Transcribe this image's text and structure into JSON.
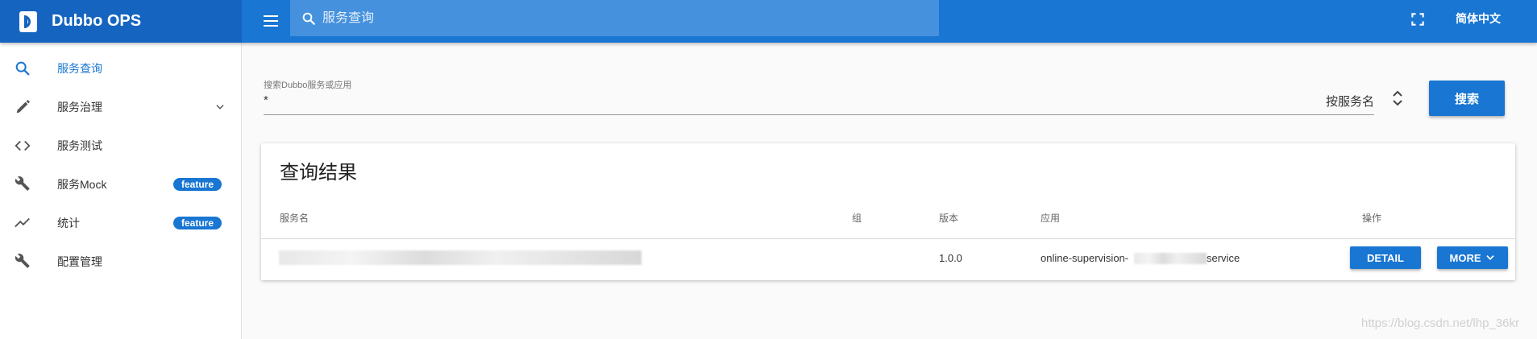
{
  "app": {
    "title": "Dubbo OPS"
  },
  "topbar": {
    "search_placeholder": "服务查询",
    "language": "简体中文"
  },
  "sidebar": {
    "items": [
      {
        "label": "服务查询",
        "icon": "search-icon",
        "active": true
      },
      {
        "label": "服务治理",
        "icon": "pencil-icon",
        "expandable": true
      },
      {
        "label": "服务测试",
        "icon": "code-icon"
      },
      {
        "label": "服务Mock",
        "icon": "wrench-icon",
        "badge": "feature"
      },
      {
        "label": "统计",
        "icon": "trending-icon",
        "badge": "feature"
      },
      {
        "label": "配置管理",
        "icon": "wrench-icon"
      }
    ]
  },
  "search": {
    "label": "搜索Dubbo服务或应用",
    "value": "*",
    "mode": "按服务名",
    "button": "搜索"
  },
  "results": {
    "title": "查询结果",
    "columns": [
      "服务名",
      "组",
      "版本",
      "应用",
      "操作"
    ],
    "rows": [
      {
        "service": "",
        "group": "",
        "version": "1.0.0",
        "application": "online-supervision-",
        "application_tail": "service",
        "detail": "DETAIL",
        "more": "MORE"
      }
    ]
  },
  "watermark": "https://blog.csdn.net/lhp_36kr",
  "colors": {
    "primary": "#1976d2",
    "brand_dark": "#1565c0",
    "search_bg": "#4591de"
  }
}
